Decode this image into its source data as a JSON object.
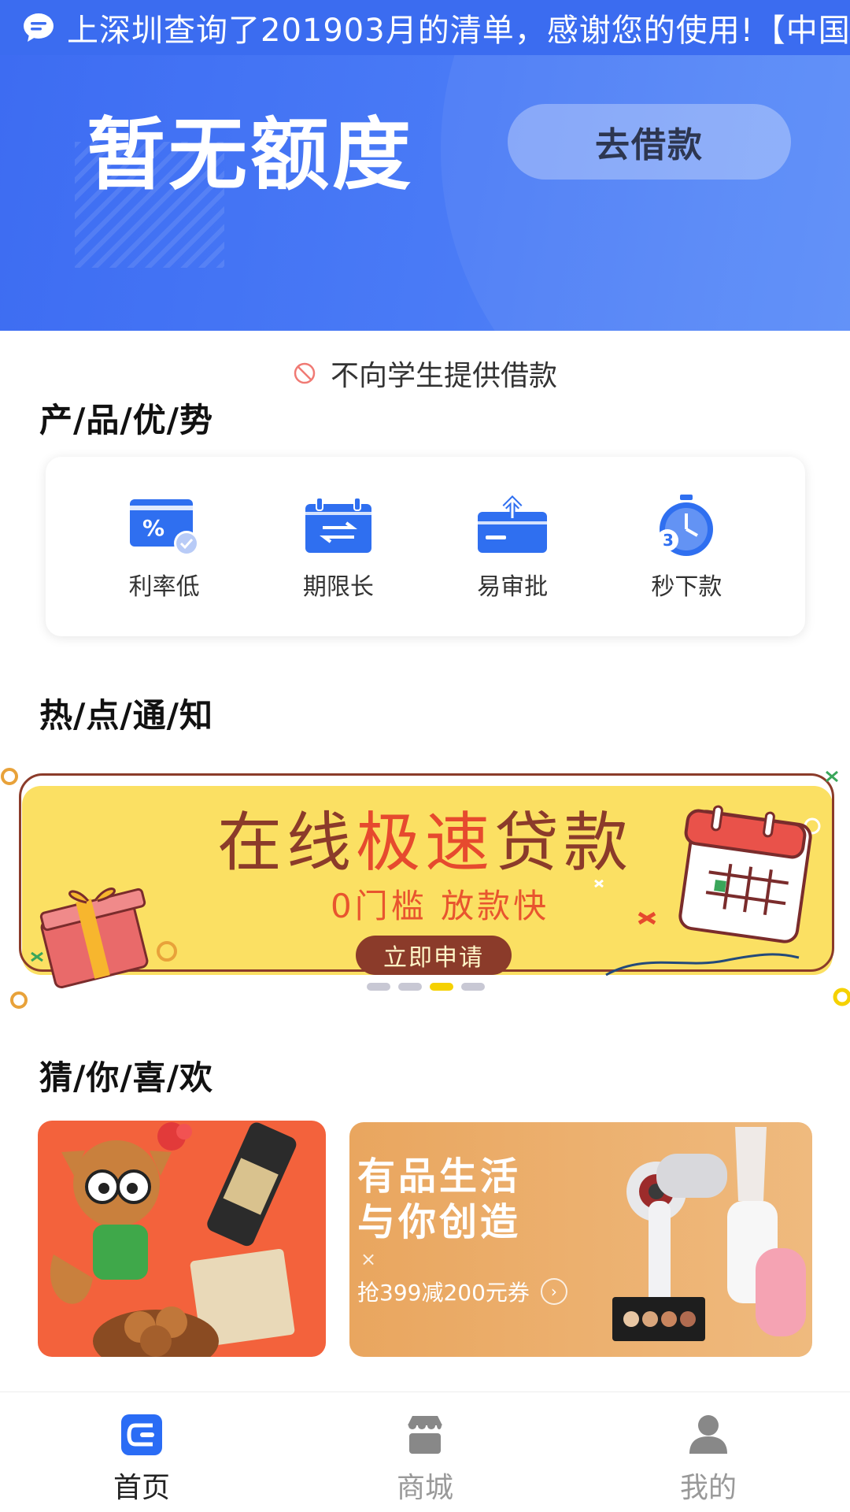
{
  "notice": {
    "text": "上深圳查询了201903月的清单，感谢您的使用!【中国"
  },
  "hero": {
    "amount_text": "暂无额度",
    "button_label": "去借款"
  },
  "student_notice": "不向学生提供借款",
  "advantages": {
    "title": "产/品/优/势",
    "items": [
      {
        "label": "利率低",
        "icon": "low-rate-card-icon"
      },
      {
        "label": "期限长",
        "icon": "calendar-exchange-icon"
      },
      {
        "label": "易审批",
        "icon": "upload-box-icon"
      },
      {
        "label": "秒下款",
        "icon": "stopwatch-icon"
      }
    ]
  },
  "hot_notice": {
    "title": "热/点/通/知",
    "banner": {
      "title_a": "在线",
      "title_highlight": "极速",
      "title_b": "贷款",
      "subtitle": "0门槛  放款快",
      "button_label": "立即申请",
      "active_dot": 2,
      "dot_count": 4
    }
  },
  "recommend": {
    "title": "猜/你/喜/欢",
    "right_card": {
      "title_line1": "有品生活",
      "title_line2": "与你创造",
      "coupon": "抢399减200元券"
    }
  },
  "nav": {
    "items": [
      {
        "label": "首页",
        "active": true
      },
      {
        "label": "商城",
        "active": false
      },
      {
        "label": "我的",
        "active": false
      }
    ]
  },
  "colors": {
    "primary": "#3b6cf0",
    "banner_yellow": "#fbe063",
    "banner_brown": "#8b3b2a",
    "accent_orange": "#e64a2e"
  }
}
